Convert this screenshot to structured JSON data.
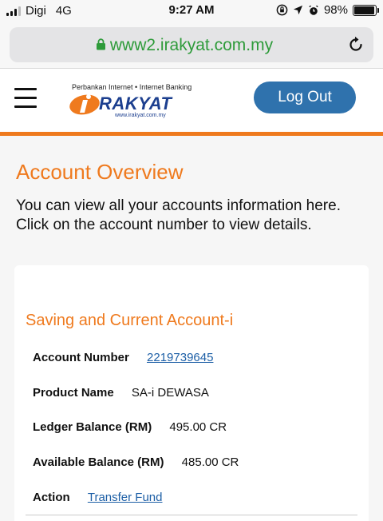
{
  "status_bar": {
    "carrier": "Digi",
    "network": "4G",
    "time": "9:27 AM",
    "battery_percent": "98%",
    "battery_level": 0.98,
    "icons": [
      "rotation-lock-icon",
      "location-arrow-icon",
      "alarm-icon"
    ]
  },
  "browser": {
    "url": "www2.irakyat.com.my",
    "lock_color": "#2e9b3a"
  },
  "header": {
    "logo_tagline": "Perbankan Internet • Internet Banking",
    "logo_word": "RAKYAT",
    "logo_url": "www.irakyat.com.my",
    "logout_label": "Log Out",
    "accent": "#ef7a1e",
    "button_color": "#2f72ad"
  },
  "page": {
    "title": "Account Overview",
    "description": "You can view all your accounts information here. Click on the account number to view details."
  },
  "account": {
    "section_title": "Saving and Current Account-i",
    "fields": {
      "account_number_label": "Account Number",
      "account_number": "2219739645",
      "product_name_label": "Product Name",
      "product_name": "SA-i DEWASA",
      "ledger_balance_label": "Ledger Balance (RM)",
      "ledger_balance": "495.00 CR",
      "available_balance_label": "Available Balance (RM)",
      "available_balance": "485.00 CR",
      "action_label": "Action",
      "action_link": "Transfer Fund"
    }
  }
}
